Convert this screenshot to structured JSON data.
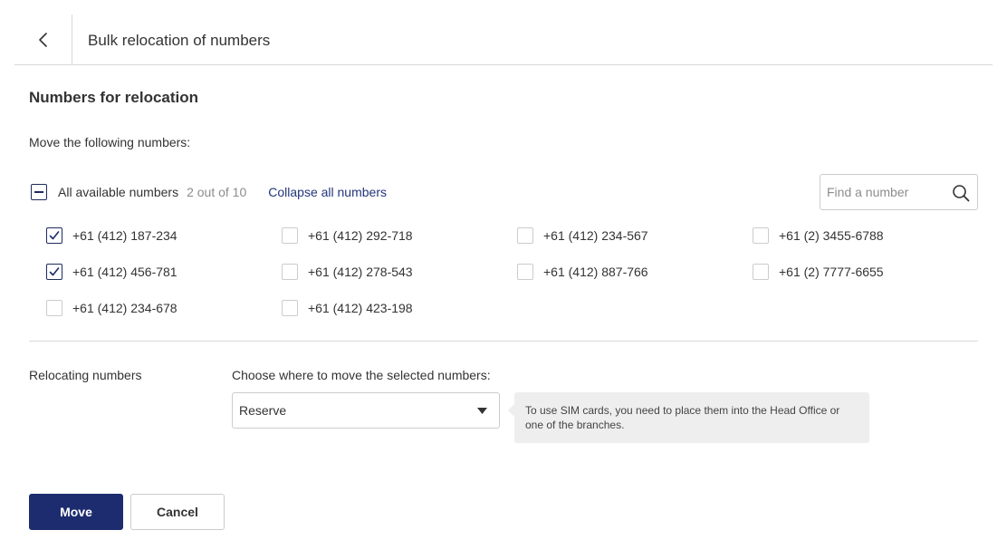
{
  "header": {
    "title": "Bulk relocation of numbers",
    "back_icon": "chevron-left-icon"
  },
  "section": {
    "title": "Numbers for relocation",
    "subtitle": "Move the following numbers:"
  },
  "selection": {
    "all_label": "All available numbers",
    "count_text": "2 out of 10",
    "collapse_link": "Collapse all numbers",
    "state": "indeterminate"
  },
  "search": {
    "placeholder": "Find a number",
    "value": "",
    "icon": "search-icon"
  },
  "numbers": [
    {
      "label": "+61 (412) 187-234",
      "checked": true
    },
    {
      "label": "+61 (412) 292-718",
      "checked": false
    },
    {
      "label": "+61 (412) 234-567",
      "checked": false
    },
    {
      "label": "+61 (2) 3455-6788",
      "checked": false
    },
    {
      "label": "+61 (412) 456-781",
      "checked": true
    },
    {
      "label": "+61 (412) 278-543",
      "checked": false
    },
    {
      "label": "+61 (412) 887-766",
      "checked": false
    },
    {
      "label": "+61 (2) 7777-6655",
      "checked": false
    },
    {
      "label": "+61 (412) 234-678",
      "checked": false
    },
    {
      "label": "+61 (412) 423-198",
      "checked": false
    }
  ],
  "relocation": {
    "label": "Relocating numbers",
    "choose_label": "Choose where to move the selected numbers:",
    "selected_value": "Reserve",
    "tooltip": "To use SIM cards, you need to place them into the Head Office or one of the branches."
  },
  "actions": {
    "move_label": "Move",
    "cancel_label": "Cancel"
  },
  "colors": {
    "accent": "#1d2c6e",
    "link": "#22357a",
    "muted_text": "#8c8c8c",
    "tooltip_bg": "#eeeeee"
  }
}
